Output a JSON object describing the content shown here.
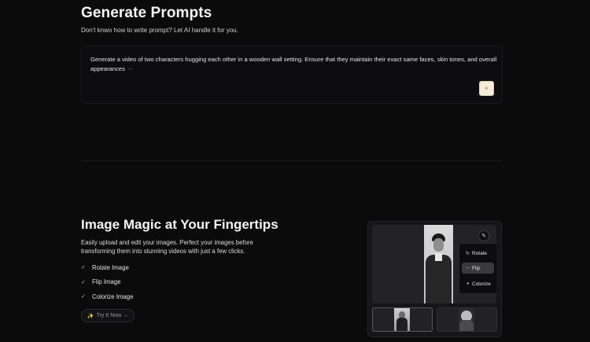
{
  "prompt_section": {
    "title": "Generate Prompts",
    "subtitle": "Don't knwo how to write prompt? Let AI handle it for you.",
    "prompt_text": "Generate a video of two characters hugging each other in a wooden wall setting. Ensure that they maintain their exact same faces, skin tones, and overall appearances",
    "generate_icon": "sparkle-icon"
  },
  "image_magic": {
    "title": "Image Magic at Your Fingertips",
    "description": "Easily upload and edit your images. Perfect your images before transforming them into stunning videos with just a few clicks.",
    "features": [
      "Rotate Image",
      "Flip Image",
      "Colorize Image"
    ],
    "try_button": "Try It Now"
  },
  "editor": {
    "edit_icon": "pencil-icon",
    "tools": [
      {
        "label": "Rotate",
        "icon": "rotate-icon",
        "active": false
      },
      {
        "label": "Flip",
        "icon": "flip-icon",
        "active": true
      },
      {
        "label": "Colorize",
        "icon": "palette-icon",
        "active": false
      }
    ]
  },
  "colors": {
    "background": "#0b0b0c",
    "text": "#ededed",
    "accent_button": "#f3ecd9"
  }
}
